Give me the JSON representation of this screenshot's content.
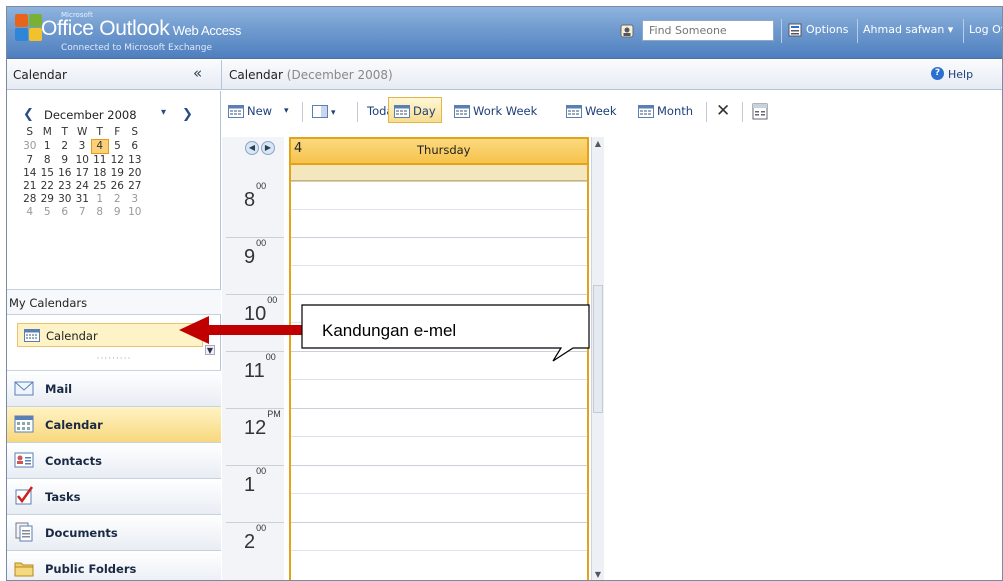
{
  "header": {
    "microsoft": "Microsoft",
    "office": "Office",
    "outlook": " Outlook",
    "web_access": " Web Access",
    "subtitle": "Connected to Microsoft Exchange",
    "find_placeholder": "Find Someone",
    "options": "Options",
    "user": "Ahmad safwan ▾",
    "logoff": "Log Off"
  },
  "left": {
    "title": "Calendar",
    "collapse": "«",
    "mini_month": "December 2008",
    "weekdays": [
      "S",
      "M",
      "T",
      "W",
      "T",
      "F",
      "S"
    ],
    "weeks": [
      [
        "30",
        "1",
        "2",
        "3",
        "4",
        "5",
        "6"
      ],
      [
        "7",
        "8",
        "9",
        "10",
        "11",
        "12",
        "13"
      ],
      [
        "14",
        "15",
        "16",
        "17",
        "18",
        "19",
        "20"
      ],
      [
        "21",
        "22",
        "23",
        "24",
        "25",
        "26",
        "27"
      ],
      [
        "28",
        "29",
        "30",
        "31",
        "1",
        "2",
        "3"
      ],
      [
        "4",
        "5",
        "6",
        "7",
        "8",
        "9",
        "10"
      ]
    ],
    "my_calendars": "My Calendars",
    "calendar_item": "Calendar",
    "nav": [
      {
        "label": "Mail",
        "icon": "mail-icon",
        "active": false
      },
      {
        "label": "Calendar",
        "icon": "calendar-icon",
        "active": true
      },
      {
        "label": "Contacts",
        "icon": "contacts-icon",
        "active": false
      },
      {
        "label": "Tasks",
        "icon": "tasks-icon",
        "active": false
      },
      {
        "label": "Documents",
        "icon": "documents-icon",
        "active": false
      },
      {
        "label": "Public Folders",
        "icon": "public-folders-icon",
        "active": false
      }
    ]
  },
  "main": {
    "title": "Calendar",
    "subtitle": " (December 2008)",
    "help": "Help",
    "toolbar": {
      "new": "New",
      "today": "Today",
      "day": "Day",
      "work_week": "Work Week",
      "week": "Week",
      "month": "Month",
      "delete": "✕"
    },
    "day_number": "4",
    "day_name": "Thursday",
    "times": [
      {
        "hour": "8",
        "suffix": "00"
      },
      {
        "hour": "9",
        "suffix": "00"
      },
      {
        "hour": "10",
        "suffix": "00"
      },
      {
        "hour": "11",
        "suffix": "00"
      },
      {
        "hour": "12",
        "suffix": "PM"
      },
      {
        "hour": "1",
        "suffix": "00"
      },
      {
        "hour": "2",
        "suffix": "00"
      }
    ]
  },
  "annotation": {
    "text": "Kandungan e-mel"
  },
  "colors": {
    "header_blue": "#4f7fbf",
    "selected_yellow": "#f8d87e",
    "day_border": "#e3a21a",
    "arrow_red": "#c00000"
  }
}
